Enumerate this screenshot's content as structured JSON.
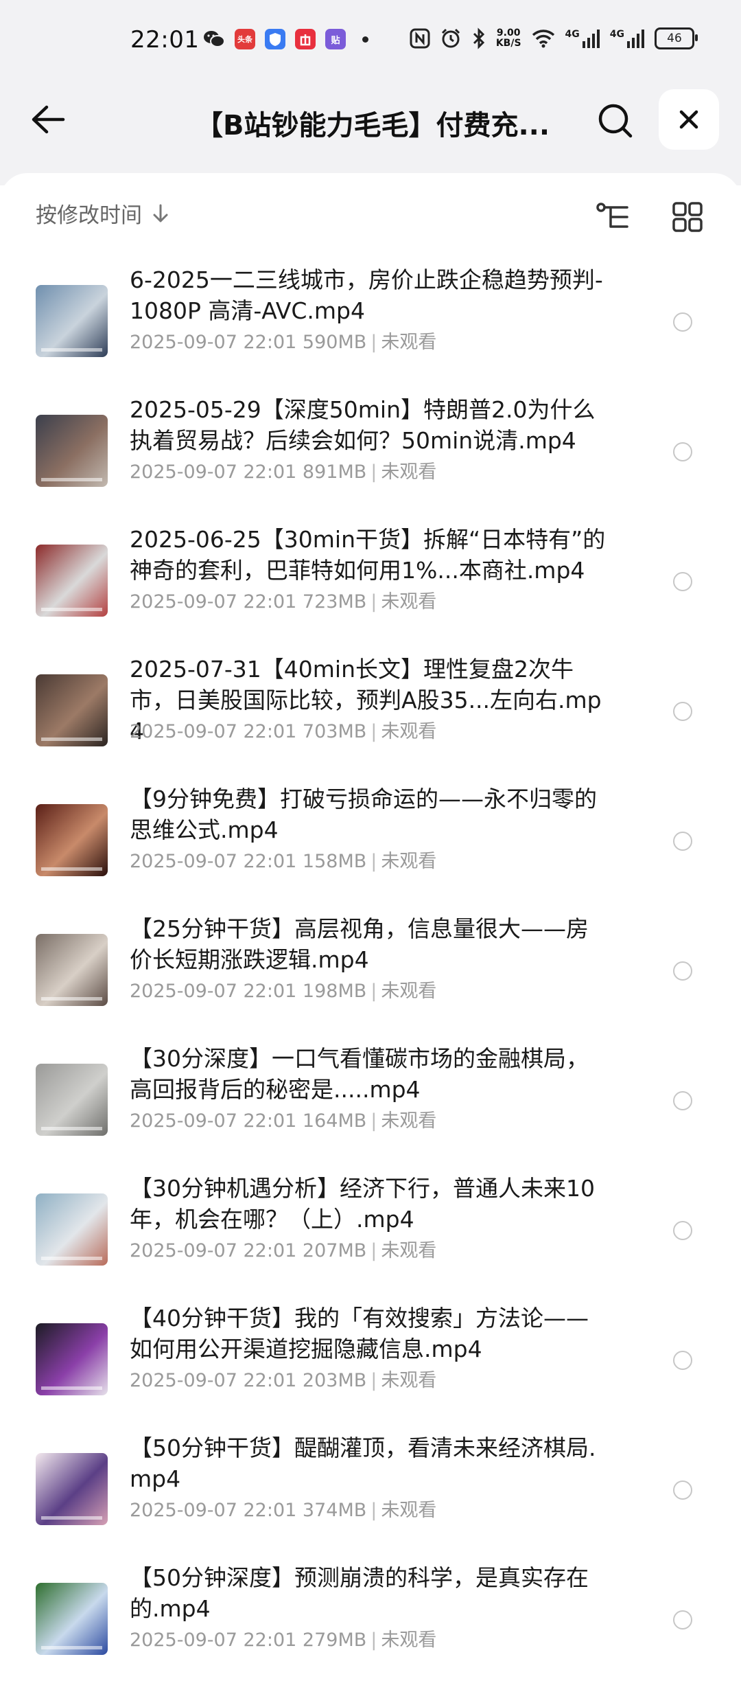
{
  "status_bar": {
    "time": "22:01",
    "net_speed_value": "9.00",
    "net_speed_unit": "KB/S",
    "signal_label_1": "4G",
    "signal_label_2": "4G",
    "battery": "46",
    "app_badge_toutiao": "头条",
    "app_badge_tie": "贴"
  },
  "header": {
    "title": "【B站钞能力毛毛】付费充..."
  },
  "toolbar": {
    "sort_label": "按修改时间"
  },
  "files": [
    {
      "name": "6-2025一二三线城市，房价止跌企稳趋势预判-1080P 高清-AVC.mp4",
      "date": "2025-09-07 22:01",
      "size": "590MB",
      "status": "未观看",
      "thumb_colors": [
        "#6f8fae",
        "#c9d3dc",
        "#2e3d57"
      ]
    },
    {
      "name": "2025-05-29【深度50min】特朗普2.0为什么执着贸易战？后续会如何？50min说清.mp4",
      "date": "2025-09-07 22:01",
      "size": "891MB",
      "status": "未观看",
      "thumb_colors": [
        "#3b3f4c",
        "#8b6f62",
        "#c2b9b0"
      ]
    },
    {
      "name": "2025-06-25【30min干货】拆解“日本特有”的神奇的套利，巴菲特如何用1%...本商社.mp4",
      "date": "2025-09-07 22:01",
      "size": "723MB",
      "status": "未观看",
      "thumb_colors": [
        "#8c2a2a",
        "#d9d9d9",
        "#b34040"
      ]
    },
    {
      "name": "2025-07-31【40min长文】理性复盘2次牛市，日美股国际比较，预判A股35...左向右.mp4",
      "date": "2025-09-07 22:01",
      "size": "703MB",
      "status": "未观看",
      "thumb_colors": [
        "#4a3a34",
        "#9c7a66",
        "#2b2421"
      ]
    },
    {
      "name": "【9分钟免费】打破亏损命运的——永不归零的思维公式.mp4",
      "date": "2025-09-07 22:01",
      "size": "158MB",
      "status": "未观看",
      "thumb_colors": [
        "#5a1f17",
        "#c88a6a",
        "#2a0f0c"
      ]
    },
    {
      "name": "【25分钟干货】高层视角，信息量很大——房价长短期涨跌逻辑.mp4",
      "date": "2025-09-07 22:01",
      "size": "198MB",
      "status": "未观看",
      "thumb_colors": [
        "#7a6e66",
        "#d8cfc6",
        "#5b4b44"
      ]
    },
    {
      "name": "【30分深度】一口气看懂碳市场的金融棋局，高回报背后的秘密是.....mp4",
      "date": "2025-09-07 22:01",
      "size": "164MB",
      "status": "未观看",
      "thumb_colors": [
        "#9a9a98",
        "#cfcfcc",
        "#6e6e6b"
      ]
    },
    {
      "name": "【30分钟机遇分析】经济下行，普通人未来10年，机会在哪？（上）.mp4",
      "date": "2025-09-07 22:01",
      "size": "207MB",
      "status": "未观看",
      "thumb_colors": [
        "#8fb0c4",
        "#e2e6ea",
        "#b86b5a"
      ]
    },
    {
      "name": "【40分钟干货】我的「有效搜索」方法论——如何用公开渠道挖掘隐藏信息.mp4",
      "date": "2025-09-07 22:01",
      "size": "203MB",
      "status": "未观看",
      "thumb_colors": [
        "#1c1c24",
        "#8a3fa8",
        "#e6e1ea"
      ]
    },
    {
      "name": "【50分钟干货】醍醐灌顶，看清未来经济棋局.mp4",
      "date": "2025-09-07 22:01",
      "size": "374MB",
      "status": "未观看",
      "thumb_colors": [
        "#f3e9ee",
        "#5b3f86",
        "#d6a0b4"
      ]
    },
    {
      "name": "【50分钟深度】预测崩溃的科学，是真实存在的.mp4",
      "date": "2025-09-07 22:01",
      "size": "279MB",
      "status": "未观看",
      "thumb_colors": [
        "#2f6f2f",
        "#c8d9ec",
        "#2c4aa0"
      ]
    }
  ]
}
